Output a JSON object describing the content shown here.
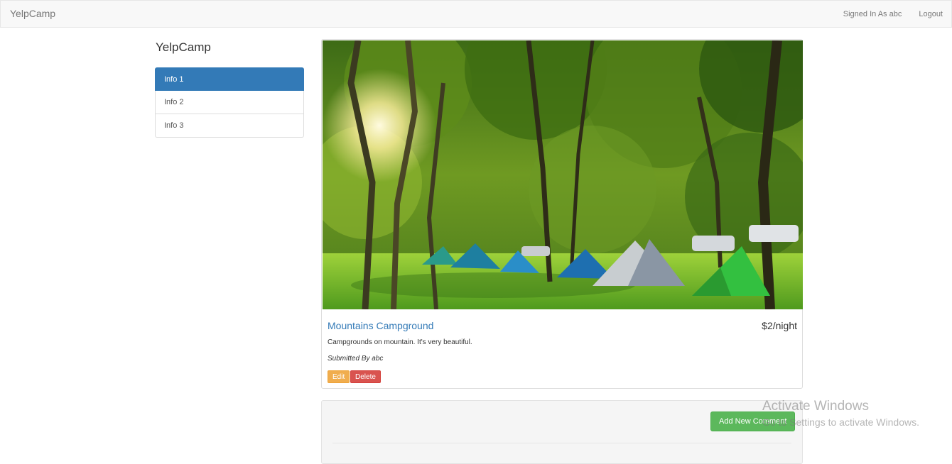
{
  "navbar": {
    "brand": "YelpCamp",
    "signed_in": "Signed In As abc",
    "logout": "Logout"
  },
  "sidebar": {
    "title": "YelpCamp",
    "items": [
      {
        "label": "Info 1",
        "active": true
      },
      {
        "label": "Info 2",
        "active": false
      },
      {
        "label": "Info 3",
        "active": false
      }
    ]
  },
  "campground": {
    "image_alt": "tents-among-trees-photo",
    "name": "Mountains Campground",
    "price": "$2/night",
    "description": "Campgrounds on mountain. It's very beautiful.",
    "submitted_by": "Submitted By abc",
    "edit_label": "Edit",
    "delete_label": "Delete"
  },
  "comments": {
    "add_label": "Add New Comment"
  },
  "watermark": {
    "title": "Activate Windows",
    "subtitle": "Go to Settings to activate Windows."
  },
  "colors": {
    "primary": "#337ab7",
    "warning": "#f0ad4e",
    "danger": "#d9534f",
    "success": "#5cb85c"
  }
}
